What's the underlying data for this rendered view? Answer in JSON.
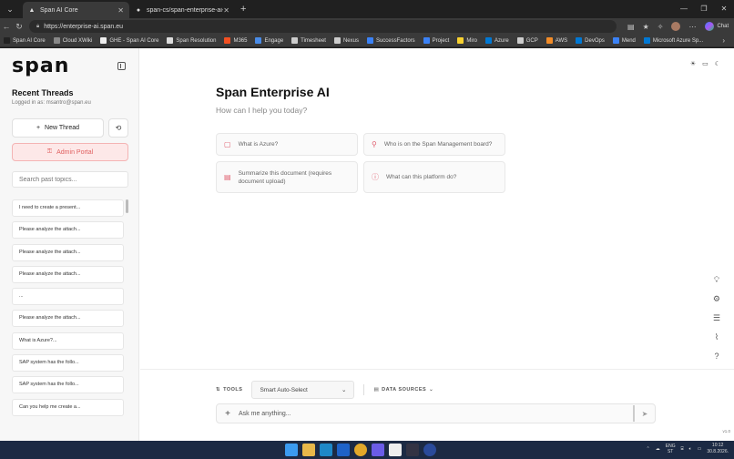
{
  "browser": {
    "tabs": [
      {
        "label": "Span AI Core",
        "active": true
      },
      {
        "label": "span-cs/span-enterprise-ai-core",
        "active": false
      }
    ],
    "url": "https://enterprise-ai.span.eu",
    "bookmarks": [
      {
        "label": "Span AI Core",
        "color": "#222"
      },
      {
        "label": "Cloud XWiki",
        "color": "#888"
      },
      {
        "label": "GHE - Span AI Core",
        "color": "#eee"
      },
      {
        "label": "Span Resolution",
        "color": "#ddd"
      },
      {
        "label": "M365",
        "color": "#f25022"
      },
      {
        "label": "Engage",
        "color": "#4a8ce8"
      },
      {
        "label": "Timesheet",
        "color": "#ccc"
      },
      {
        "label": "Nexus",
        "color": "#ccc"
      },
      {
        "label": "SuccessFactors",
        "color": "#3b82f6"
      },
      {
        "label": "Project",
        "color": "#3b82f6"
      },
      {
        "label": "Miro",
        "color": "#f8d12f"
      },
      {
        "label": "Azure",
        "color": "#0078d4"
      },
      {
        "label": "GCP",
        "color": "#ccc"
      },
      {
        "label": "AWS",
        "color": "#f28c28"
      },
      {
        "label": "DevOps",
        "color": "#0078d4"
      },
      {
        "label": "Mend",
        "color": "#3b82f6"
      },
      {
        "label": "Microsoft Azure Sp...",
        "color": "#0078d4"
      }
    ],
    "copilot_label": "Chat"
  },
  "sidebar": {
    "logo": "span",
    "heading": "Recent Threads",
    "logged_in": "Logged in as: msantro@span.eu",
    "new_thread": "New Thread",
    "admin_portal": "Admin Portal",
    "search_placeholder": "Search past topics...",
    "threads": [
      "I need to create a present...",
      "Please analyze the attach...",
      "Please analyze the attach...",
      "Please analyze the attach...",
      "...",
      "Please analyze the attach...",
      "What is Azure?...",
      "SAP system has the follo...",
      "SAP system has the follo...",
      "Can you help me create a..."
    ]
  },
  "main": {
    "title": "Span Enterprise AI",
    "subtitle": "How can I help you today?",
    "suggestions": [
      "What is Azure?",
      "Who is on the Span Management board?",
      "Summarize this document (requires document upload)",
      "What can this platform do?"
    ],
    "tools_label": "TOOLS",
    "model_select": "Smart Auto-Select",
    "data_sources_label": "DATA SOURCES",
    "input_placeholder": "Ask me anything...",
    "version": "v1.0"
  },
  "taskbar": {
    "lang_line1": "ENG",
    "lang_line2": "ST",
    "time": "10:12",
    "date": "30.8.2026."
  }
}
